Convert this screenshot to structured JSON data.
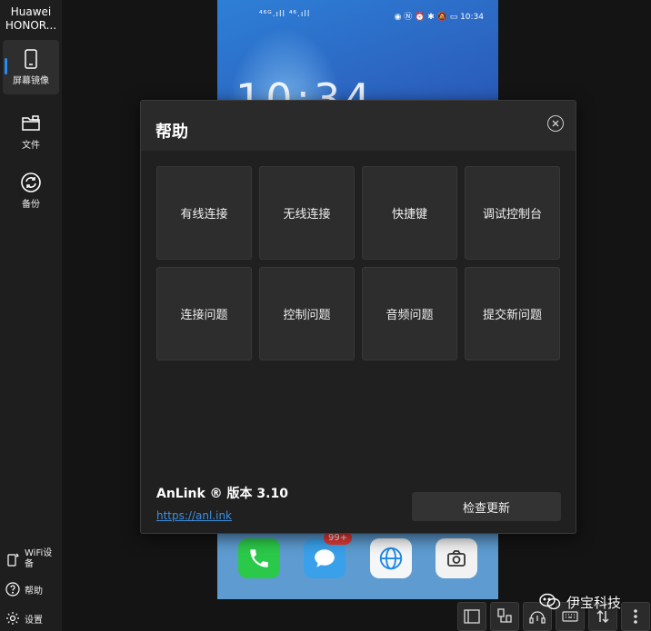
{
  "sidebar": {
    "device_name": "Huawei HONOR...",
    "nav": [
      {
        "label": "屏幕镜像",
        "icon": "phone-icon",
        "active": true
      },
      {
        "label": "文件",
        "icon": "folder-icon",
        "active": false
      },
      {
        "label": "备份",
        "icon": "sync-icon",
        "active": false
      }
    ],
    "bottom": [
      {
        "label": "WiFi设\n备",
        "icon": "wifi-phone-icon"
      },
      {
        "label": "帮助",
        "icon": "question-icon"
      },
      {
        "label": "设置",
        "icon": "gear-icon"
      }
    ]
  },
  "phone": {
    "status_left": "⁴⁶ᴳ.ıll ⁴⁶.ıll",
    "status_time": "10:34",
    "clock": "10:34",
    "badge": "99+"
  },
  "dialog": {
    "title": "帮助",
    "tiles": [
      "有线连接",
      "无线连接",
      "快捷键",
      "调试控制台",
      "连接问题",
      "控制问题",
      "音频问题",
      "提交新问题"
    ],
    "version": "AnLink ® 版本 3.10",
    "link": "https://anl.ink",
    "update_label": "检查更新"
  },
  "watermark": "伊宝科技",
  "colors": {
    "accent": "#2a8cf0",
    "link": "#3d8fe0",
    "badge": "#e53935"
  }
}
